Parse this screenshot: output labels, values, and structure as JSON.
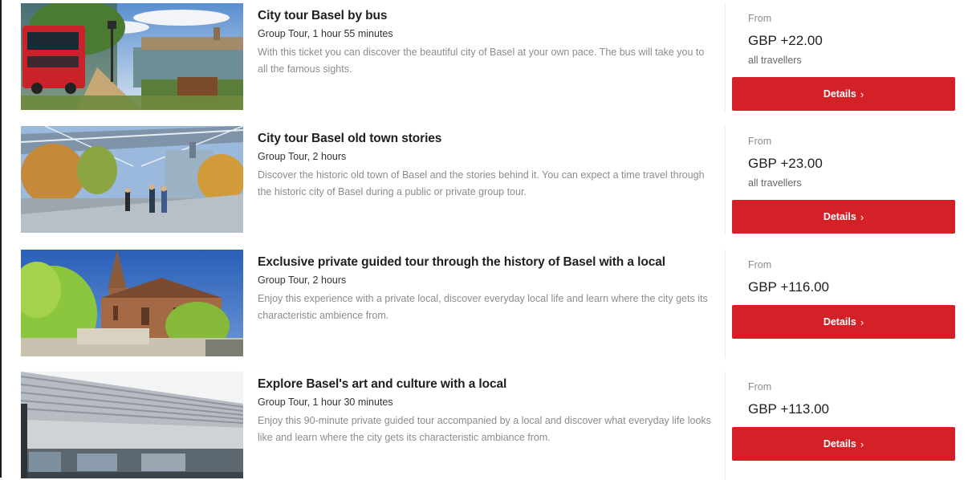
{
  "tours": [
    {
      "title": "City tour Basel by bus",
      "meta": "Group Tour, 1 hour 55 minutes",
      "description": "With this ticket you can discover the beautiful city of Basel at your own pace. The bus will take you to all the famous sights.",
      "from_label": "From",
      "price": "GBP +22.00",
      "travellers": "all travellers",
      "button_label": "Details",
      "image": "bus-riverside-photo"
    },
    {
      "title": "City tour Basel old town stories",
      "meta": "Group Tour, 2 hours",
      "description": "Discover the historic old town of Basel and the stories behind it. You can expect a time travel through the historic city of Basel during a public or private group tour.",
      "from_label": "From",
      "price": "GBP +23.00",
      "travellers": "all travellers",
      "button_label": "Details",
      "image": "old-town-plaza-photo"
    },
    {
      "title": "Exclusive private guided tour through the history of Basel with a local",
      "meta": "Group Tour, 2 hours",
      "description": "Enjoy this experience with a private local, discover everyday local life and learn where the city gets its characteristic ambience from.",
      "from_label": "From",
      "price": "GBP +116.00",
      "travellers": "",
      "button_label": "Details",
      "image": "cathedral-photo"
    },
    {
      "title": "Explore Basel's art and culture with a local",
      "meta": "Group Tour, 1 hour 30 minutes",
      "description": "Enjoy this 90-minute private guided tour accompanied by a local and discover what everyday life looks like and learn where the city gets its characteristic ambiance from.",
      "from_label": "From",
      "price": "GBP +113.00",
      "travellers": "",
      "button_label": "Details",
      "image": "modern-hall-photo"
    }
  ],
  "button_chevron": "›",
  "accent_color": "#d42027"
}
